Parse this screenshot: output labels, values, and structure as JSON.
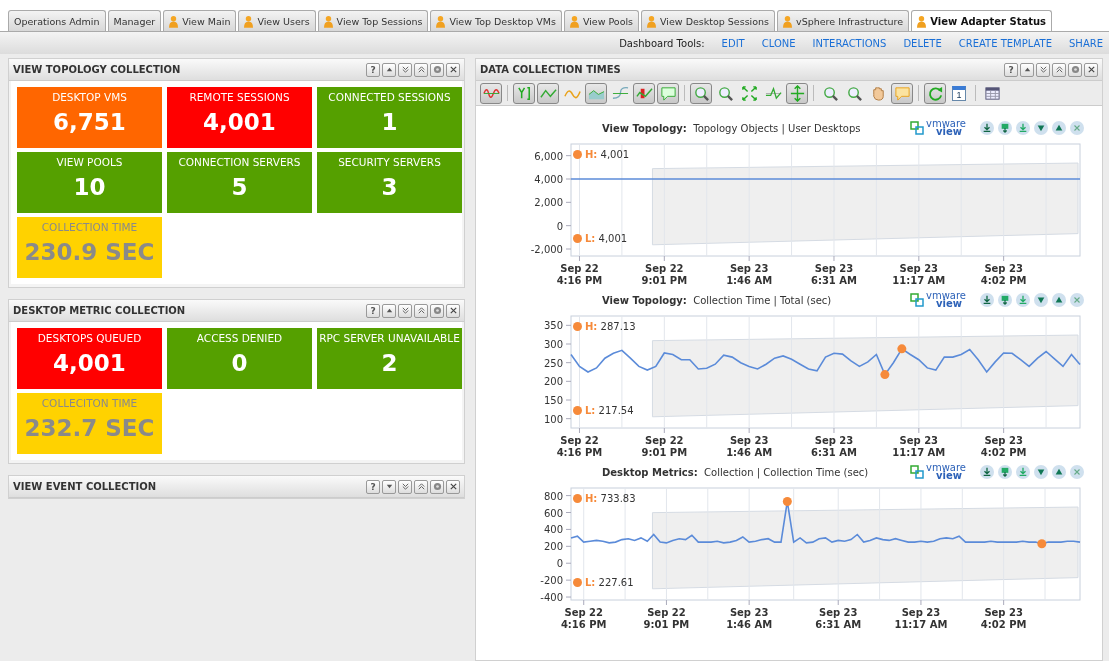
{
  "tabs": [
    {
      "label": "Operations Admin",
      "selected": false,
      "shared": false
    },
    {
      "label": "Manager",
      "selected": false,
      "shared": false
    },
    {
      "label": "View Main",
      "selected": false,
      "shared": true
    },
    {
      "label": "View Users",
      "selected": false,
      "shared": true
    },
    {
      "label": "View Top Sessions",
      "selected": false,
      "shared": true
    },
    {
      "label": "View Top Desktop VMs",
      "selected": false,
      "shared": true
    },
    {
      "label": "View Pools",
      "selected": false,
      "shared": true
    },
    {
      "label": "View Desktop Sessions",
      "selected": false,
      "shared": true
    },
    {
      "label": "vSphere Infrastructure",
      "selected": false,
      "shared": true
    },
    {
      "label": "View Adapter Status",
      "selected": true,
      "shared": true
    }
  ],
  "dashboard_tools": {
    "label": "Dashboard Tools:",
    "links": [
      "EDIT",
      "CLONE",
      "INTERACTIONS",
      "DELETE",
      "CREATE TEMPLATE",
      "SHARE"
    ]
  },
  "left_panels": [
    {
      "title": "VIEW TOPOLOGY COLLECTION",
      "help": "?",
      "collapsed": false,
      "tiles": [
        {
          "label": "DESKTOP VMS",
          "value": "6,751",
          "color": "#ff6600",
          "kind": "count"
        },
        {
          "label": "REMOTE SESSIONS",
          "value": "4,001",
          "color": "#ff0000",
          "kind": "count"
        },
        {
          "label": "CONNECTED SESSIONS",
          "value": "1",
          "color": "#55a000",
          "kind": "count"
        },
        {
          "label": "VIEW POOLS",
          "value": "10",
          "color": "#55a000",
          "kind": "count"
        },
        {
          "label": "CONNECTION SERVERS",
          "value": "5",
          "color": "#55a000",
          "kind": "count"
        },
        {
          "label": "SECURITY SERVERS",
          "value": "3",
          "color": "#55a000",
          "kind": "count"
        },
        {
          "label": "COLLECTION TIME",
          "value": "230.9 SEC",
          "color": "#ffd200",
          "kind": "time"
        }
      ]
    },
    {
      "title": "DESKTOP METRIC COLLECTION",
      "help": "?",
      "collapsed": false,
      "tiles": [
        {
          "label": "DESKTOPS QUEUED",
          "value": "4,001",
          "color": "#ff0000",
          "kind": "count"
        },
        {
          "label": "ACCESS DENIED",
          "value": "0",
          "color": "#55a000",
          "kind": "count"
        },
        {
          "label": "RPC SERVER UNAVAILABLE",
          "value": "2",
          "color": "#55a000",
          "kind": "count"
        },
        {
          "label": "COLLECITON TIME",
          "value": "232.7 SEC",
          "color": "#ffd200",
          "kind": "time"
        }
      ]
    },
    {
      "title": "VIEW EVENT COLLECTION",
      "help": "?",
      "collapsed": true
    }
  ],
  "right_panel": {
    "title": "DATA COLLECTION TIMES",
    "help": "?",
    "toolbar": [
      {
        "kind": "wave",
        "pressed": true
      },
      {
        "kind": "separator"
      },
      {
        "kind": "y-scale",
        "pressed": true
      },
      {
        "kind": "line",
        "pressed": true
      },
      {
        "kind": "curve",
        "pressed": false
      },
      {
        "kind": "area",
        "pressed": true
      },
      {
        "kind": "spline",
        "pressed": false
      },
      {
        "kind": "bars",
        "pressed": true
      },
      {
        "kind": "comment",
        "pressed": true
      },
      {
        "kind": "separator"
      },
      {
        "kind": "zoom-x",
        "pressed": true
      },
      {
        "kind": "zoom-y",
        "pressed": false
      },
      {
        "kind": "fit",
        "pressed": false
      },
      {
        "kind": "step",
        "pressed": false
      },
      {
        "kind": "stack",
        "pressed": true
      },
      {
        "kind": "separator"
      },
      {
        "kind": "zoom-in",
        "pressed": false
      },
      {
        "kind": "zoom-select",
        "pressed": false
      },
      {
        "kind": "hand",
        "pressed": false
      },
      {
        "kind": "note",
        "pressed": true
      },
      {
        "kind": "separator"
      },
      {
        "kind": "refresh",
        "pressed": true
      },
      {
        "kind": "calendar",
        "pressed": false,
        "text": "1"
      },
      {
        "kind": "separator"
      },
      {
        "kind": "table",
        "pressed": false
      }
    ],
    "charts": [
      {
        "title": "View Topology:",
        "subtitle": "Topology Objects | User Desktops",
        "logo": [
          "vmware",
          "view"
        ],
        "high_label": "H:",
        "high": "4,001",
        "low_label": "L:",
        "low": "4,001",
        "chart_data": {
          "type": "line",
          "grid": true,
          "ylim": [
            -2600,
            7000
          ],
          "yticks": [
            {
              "value": -2000,
              "label": "-2,000"
            },
            {
              "value": 0,
              "label": "0"
            },
            {
              "value": 2000,
              "label": "2,000"
            },
            {
              "value": 4000,
              "label": "4,000"
            },
            {
              "value": 6000,
              "label": "6,000"
            }
          ],
          "categories": [
            null,
            "Sep 22\n4:16 PM",
            null,
            null,
            null,
            null,
            null,
            null,
            null,
            null,
            null,
            "Sep 22\n9:01 PM",
            null,
            null,
            null,
            null,
            null,
            null,
            null,
            null,
            null,
            "Sep 23\n1:46 AM",
            null,
            null,
            null,
            null,
            null,
            null,
            null,
            null,
            null,
            "Sep 23\n6:31 AM",
            null,
            null,
            null,
            null,
            null,
            null,
            null,
            null,
            null,
            "Sep 23\n11:17 AM",
            null,
            null,
            null,
            null,
            null,
            null,
            null,
            null,
            null,
            "Sep 23\n4:02 PM",
            null,
            null,
            null,
            null,
            null,
            null,
            null,
            null,
            null
          ],
          "series": [
            {
              "color": "#5b8bd9",
              "values": [
                4000,
                4000,
                4000,
                4000,
                4000,
                4000,
                4000,
                4000,
                4000,
                4000,
                4000,
                4000,
                4000,
                4000,
                4000,
                4000,
                4000,
                4000,
                4000,
                4000,
                4000,
                4000,
                4000,
                4000,
                4000,
                4000,
                4000,
                4000,
                4000,
                4000,
                4000,
                4000,
                4000,
                4000,
                4000,
                4000,
                4000,
                4000,
                4000,
                4000,
                4000,
                4000,
                4000,
                4000,
                4000,
                4000,
                4000,
                4000,
                4000,
                4000,
                4000,
                4000,
                4000,
                4000,
                4000,
                4000,
                4000,
                4000,
                4000,
                4000,
                4000
              ]
            }
          ]
        }
      },
      {
        "title": "View Topology:",
        "subtitle": "Collection Time | Total (sec)",
        "logo": [
          "vmware",
          "view"
        ],
        "high_label": "H:",
        "high": "287.13",
        "low_label": "L:",
        "low": "217.54",
        "chart_data": {
          "type": "line",
          "grid": true,
          "ylim": [
            75,
            375
          ],
          "yticks": [
            100,
            150,
            200,
            250,
            300,
            350
          ],
          "categories": [
            null,
            "Sep 22\n4:16 PM",
            null,
            null,
            null,
            null,
            null,
            null,
            null,
            null,
            null,
            "Sep 22\n9:01 PM",
            null,
            null,
            null,
            null,
            null,
            null,
            null,
            null,
            null,
            "Sep 23\n1:46 AM",
            null,
            null,
            null,
            null,
            null,
            null,
            null,
            null,
            null,
            "Sep 23\n6:31 AM",
            null,
            null,
            null,
            null,
            null,
            null,
            null,
            null,
            null,
            "Sep 23\n11:17 AM",
            null,
            null,
            null,
            null,
            null,
            null,
            null,
            null,
            null,
            "Sep 23\n4:02 PM",
            null,
            null,
            null,
            null,
            null,
            null,
            null,
            null,
            null
          ],
          "series": [
            {
              "color": "#5b8bd9",
              "values": [
                272,
                240,
                225,
                236,
                262,
                275,
                283,
                262,
                240,
                230,
                240,
                276,
                272,
                258,
                258,
                233,
                235,
                246,
                270,
                265,
                250,
                240,
                233,
                246,
                262,
                268,
                259,
                246,
                233,
                228,
                265,
                275,
                273,
                255,
                240,
                252,
                272,
                218,
                250,
                287,
                272,
                258,
                236,
                230,
                265,
                265,
                272,
                285,
                258,
                225,
                252,
                276,
                275,
                258,
                240,
                262,
                280,
                260,
                240,
                272,
                245
              ]
            }
          ]
        }
      },
      {
        "title": "Desktop Metrics:",
        "subtitle": "Collection | Collection Time (sec)",
        "logo": [
          "vmware",
          "view"
        ],
        "high_label": "H:",
        "high": "733.83",
        "low_label": "L:",
        "low": "227.61",
        "chart_data": {
          "type": "line",
          "grid": true,
          "ylim": [
            -435,
            890
          ],
          "yticks": [
            -400,
            -200,
            0,
            200,
            400,
            600,
            800
          ],
          "categories": [
            null,
            null,
            "Sep 22\n4:16 PM",
            null,
            null,
            null,
            null,
            null,
            null,
            null,
            null,
            null,
            null,
            null,
            null,
            "Sep 22\n9:01 PM",
            null,
            null,
            null,
            null,
            null,
            null,
            null,
            null,
            null,
            null,
            null,
            null,
            "Sep 23\n1:46 AM",
            null,
            null,
            null,
            null,
            null,
            null,
            null,
            null,
            null,
            null,
            null,
            null,
            null,
            "Sep 23\n6:31 AM",
            null,
            null,
            null,
            null,
            null,
            null,
            null,
            null,
            null,
            null,
            null,
            null,
            "Sep 23\n11:17 AM",
            null,
            null,
            null,
            null,
            null,
            null,
            null,
            null,
            null,
            null,
            null,
            null,
            "Sep 23\n4:02 PM",
            null,
            null,
            null,
            null,
            null,
            null,
            null,
            null,
            null,
            null,
            null,
            null
          ],
          "series": [
            {
              "color": "#5b8bd9",
              "values": [
                300,
                320,
                250,
                260,
                270,
                260,
                240,
                250,
                280,
                290,
                270,
                300,
                260,
                340,
                250,
                240,
                270,
                290,
                280,
                330,
                250,
                250,
                250,
                260,
                240,
                250,
                270,
                310,
                250,
                260,
                280,
                290,
                250,
                250,
                730,
                250,
                300,
                240,
                250,
                290,
                300,
                250,
                270,
                260,
                280,
                340,
                250,
                270,
                300,
                280,
                270,
                290,
                270,
                250,
                250,
                260,
                250,
                260,
                290,
                300,
                290,
                320,
                250,
                250,
                250,
                250,
                260,
                250,
                250,
                250,
                250,
                260,
                250,
                250,
                230,
                250,
                250,
                250,
                260,
                260,
                250
              ]
            }
          ]
        }
      }
    ]
  }
}
